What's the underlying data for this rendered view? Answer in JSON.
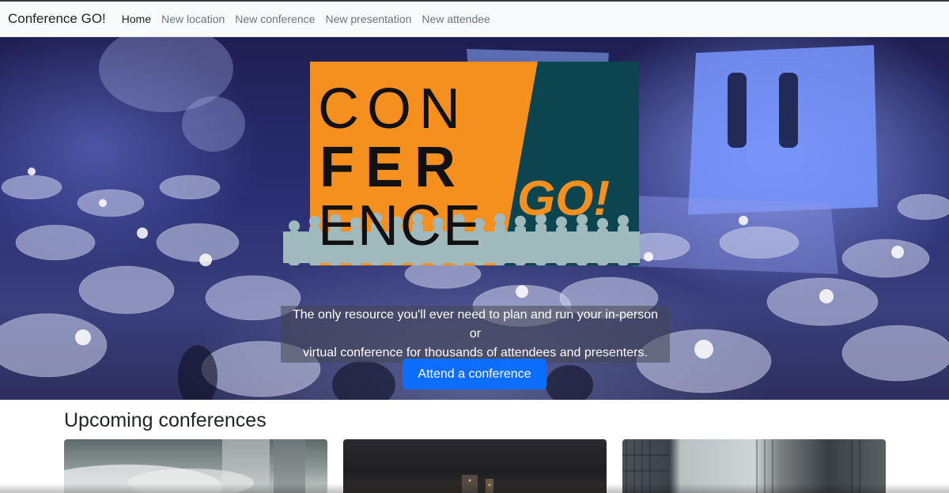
{
  "navbar": {
    "brand": "Conference GO!",
    "links": [
      {
        "label": "Home",
        "active": true
      },
      {
        "label": "New location"
      },
      {
        "label": "New conference"
      },
      {
        "label": "New presentation"
      },
      {
        "label": "New attendee"
      }
    ]
  },
  "hero": {
    "logo": {
      "line1": "CON",
      "line2": "FER",
      "line3": "ENCE",
      "go": "GO!",
      "colors": {
        "orange": "#f5901f",
        "teal": "#0c4450",
        "people": "#9fb9bd"
      }
    },
    "tagline": {
      "line1": "The only resource you'll ever need to plan and run your in-person or",
      "line2": "virtual conference for thousands of attendees and presenters."
    },
    "cta_label": "Attend a conference",
    "accent": "#0d6efd"
  },
  "upcoming": {
    "title": "Upcoming conferences"
  }
}
